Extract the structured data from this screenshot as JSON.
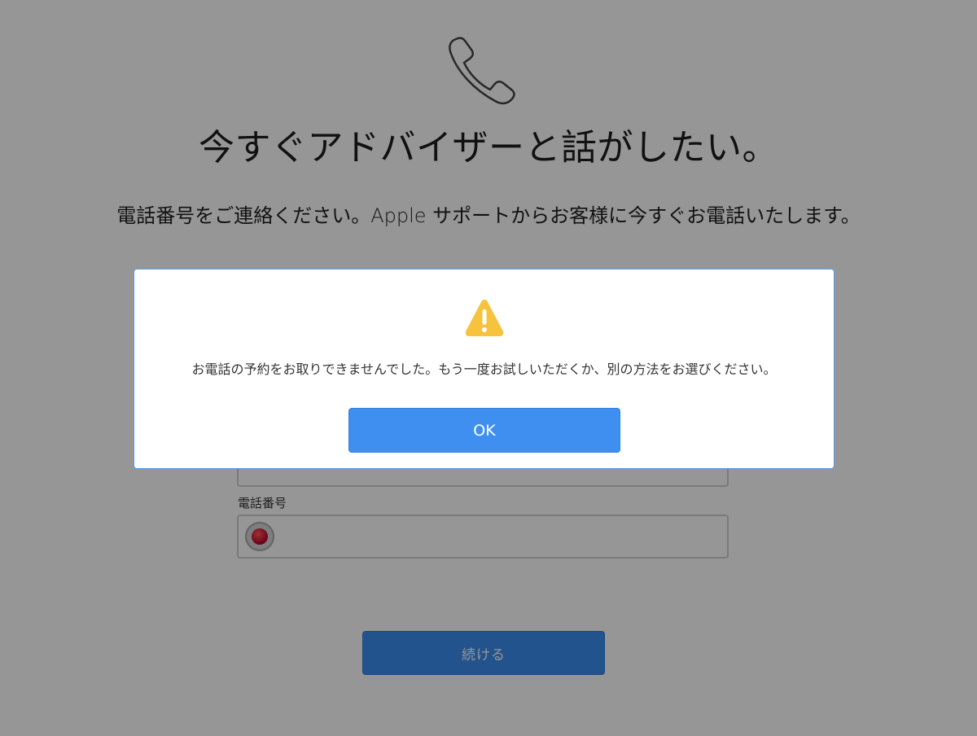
{
  "page": {
    "headline": "今すぐアドバイザーと話がしたい。",
    "subtext": "電話番号をご連絡ください。Apple サポートからお客様に今すぐお電話いたします。"
  },
  "form": {
    "email_value": "",
    "phone_label": "電話番号",
    "phone_value": "",
    "continue_label": "続ける"
  },
  "modal": {
    "icon": "warning-icon",
    "message": "お電話の予約をお取りできませんでした。もう一度お試しいただくか、別の方法をお選びください。",
    "ok_label": "OK"
  },
  "colors": {
    "accent": "#3e8fef",
    "warning": "#f7c33e",
    "overlay": "#979797"
  }
}
